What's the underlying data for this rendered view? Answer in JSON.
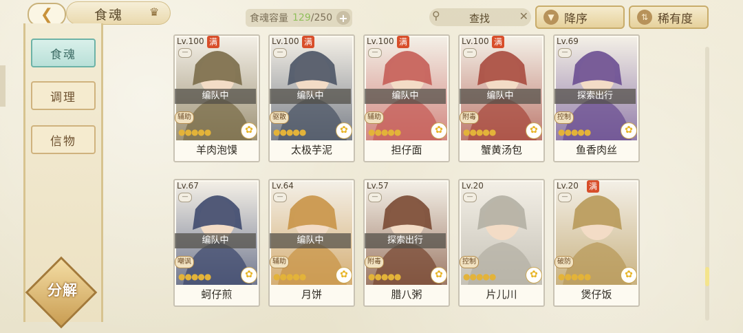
{
  "header": {
    "back_icon": "back-arrow-icon",
    "title": "食魂",
    "title_icon": "crown-icon",
    "capacity_label": "食魂容量",
    "capacity_current": "129",
    "capacity_total": "/250",
    "capacity_plus": "+",
    "search_text": "查找",
    "search_clear": "✕",
    "sort_desc_label": "降序",
    "sort_rarity_label": "稀有度"
  },
  "sidebar": {
    "tabs": [
      "食魂",
      "调理",
      "信物"
    ],
    "decompose_label": "分解"
  },
  "cards": [
    {
      "level": "Lv.100",
      "full": "满",
      "status": "编队中",
      "role": "辅助",
      "name": "羊肉泡馍",
      "hue": "#7b6d4a"
    },
    {
      "level": "Lv.100",
      "full": "满",
      "status": "编队中",
      "role": "驱散",
      "name": "太极芋泥",
      "hue": "#4c5566"
    },
    {
      "level": "Lv.100",
      "full": "满",
      "status": "编队中",
      "role": "辅助",
      "name": "担仔面",
      "hue": "#c55e58"
    },
    {
      "level": "Lv.100",
      "full": "满",
      "status": "编队中",
      "role": "附毒",
      "name": "蟹黄汤包",
      "hue": "#a84b3f"
    },
    {
      "level": "Lv.69",
      "full": "",
      "status": "探索出行",
      "role": "控制",
      "name": "鱼香肉丝",
      "hue": "#6b4f92"
    },
    {
      "level": "Lv.67",
      "full": "",
      "status": "编队中",
      "role": "嘲讽",
      "name": "蚵仔煎",
      "hue": "#3f4a6e"
    },
    {
      "level": "Lv.64",
      "full": "",
      "status": "编队中",
      "role": "辅助",
      "name": "月饼",
      "hue": "#c99548"
    },
    {
      "level": "Lv.57",
      "full": "",
      "status": "探索出行",
      "role": "附毒",
      "name": "腊八粥",
      "hue": "#7a4a34"
    },
    {
      "level": "Lv.20",
      "full": "",
      "status": "",
      "role": "控制",
      "name": "片儿川",
      "hue": "#b4b0a4"
    },
    {
      "level": "Lv.20",
      "full": "满",
      "status": "",
      "role": "破防",
      "name": "煲仔饭",
      "hue": "#b89a5a"
    }
  ],
  "colors": {
    "accent": "#c8ac6a",
    "active_tab": "#b9e0d8",
    "full_badge": "#d84e2a"
  }
}
